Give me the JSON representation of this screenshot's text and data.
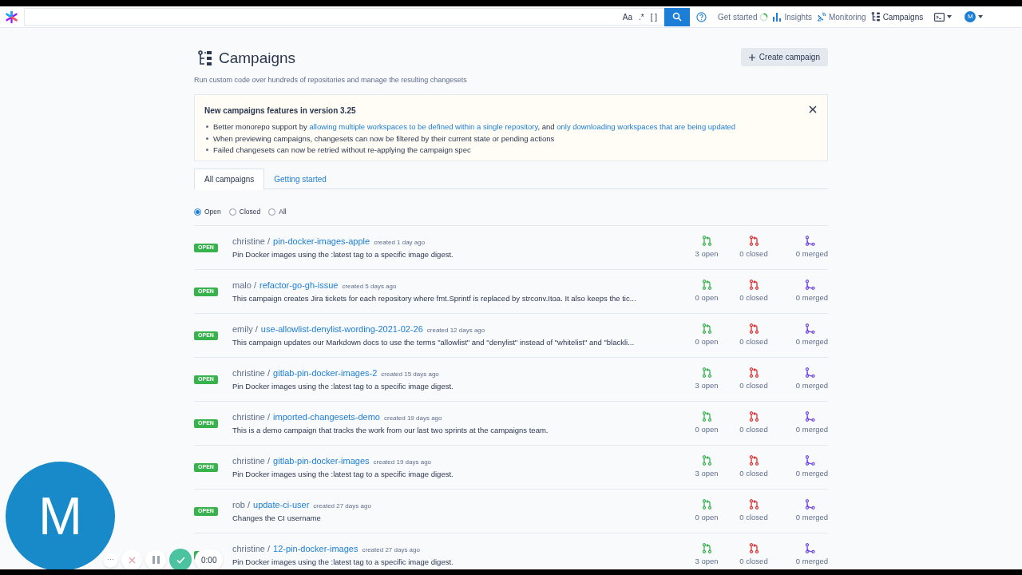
{
  "nav": {
    "search_tokens": [
      "Aa",
      ".*",
      "[ ]"
    ],
    "links": [
      {
        "label": "Get started",
        "kind": "progress"
      },
      {
        "label": "Insights",
        "kind": "insights"
      },
      {
        "label": "Monitoring",
        "kind": "monitoring"
      },
      {
        "label": "Campaigns",
        "kind": "campaigns"
      }
    ],
    "avatar": "M"
  },
  "page": {
    "title": "Campaigns",
    "subtitle": "Run custom code over hundreds of repositories and manage the resulting changesets",
    "create_button": "Create campaign"
  },
  "notice": {
    "title": "New campaigns features in version 3.25",
    "items": [
      [
        "Better monorepo support by ",
        {
          "link": "allowing multiple workspaces to be defined within a single repository"
        },
        ", and ",
        {
          "link": "only downloading workspaces that are being updated"
        }
      ],
      [
        "When previewing campaigns, changesets can now be filtered by their current state or pending actions"
      ],
      [
        "Failed changesets can now be retried without re-applying the campaign spec"
      ]
    ]
  },
  "tabs": [
    {
      "label": "All campaigns",
      "selected": true
    },
    {
      "label": "Getting started",
      "selected": false
    }
  ],
  "filters": [
    {
      "label": "Open",
      "selected": true
    },
    {
      "label": "Closed",
      "selected": false
    },
    {
      "label": "All",
      "selected": false
    }
  ],
  "campaigns": [
    {
      "badge": "OPEN",
      "namespace": "christine /",
      "name": "pin-docker-images-apple",
      "created": "created 1 day ago",
      "description": "Pin Docker images using the :latest tag to a specific image digest.",
      "open": "3 open",
      "closed": "0 closed",
      "merged": "0 merged"
    },
    {
      "badge": "OPEN",
      "namespace": "malo /",
      "name": "refactor-go-gh-issue",
      "created": "created 5 days ago",
      "description": "This campaign creates Jira tickets for each repository where fmt.Sprintf is replaced by strconv.Itoa. It also keeps the tic...",
      "open": "0 open",
      "closed": "0 closed",
      "merged": "0 merged"
    },
    {
      "badge": "OPEN",
      "namespace": "emily /",
      "name": "use-allowlist-denylist-wording-2021-02-26",
      "created": "created 12 days ago",
      "description": "This campaign updates our Markdown docs to use the terms \"allowlist\" and \"denylist\" instead of \"whitelist\" and \"blackli...",
      "open": "0 open",
      "closed": "0 closed",
      "merged": "0 merged"
    },
    {
      "badge": "OPEN",
      "namespace": "christine /",
      "name": "gitlab-pin-docker-images-2",
      "created": "created 15 days ago",
      "description": "Pin Docker images using the :latest tag to a specific image digest.",
      "open": "3 open",
      "closed": "0 closed",
      "merged": "0 merged"
    },
    {
      "badge": "OPEN",
      "namespace": "christine /",
      "name": "imported-changesets-demo",
      "created": "created 19 days ago",
      "description": "This is a demo campaign that tracks the work from our last two sprints at the campaigns team.",
      "open": "0 open",
      "closed": "0 closed",
      "merged": "0 merged"
    },
    {
      "badge": "OPEN",
      "namespace": "christine /",
      "name": "gitlab-pin-docker-images",
      "created": "created 19 days ago",
      "description": "Pin Docker images using the :latest tag to a specific image digest.",
      "open": "3 open",
      "closed": "0 closed",
      "merged": "0 merged"
    },
    {
      "badge": "OPEN",
      "namespace": "rob /",
      "name": "update-ci-user",
      "created": "created 27 days ago",
      "description": "Changes the CI username",
      "open": "0 open",
      "closed": "0 closed",
      "merged": "0 merged"
    },
    {
      "namespace": "christine /",
      "name": "12-pin-docker-images",
      "created": "created 27 days ago",
      "description": "Pin Docker images using the :latest tag to a specific image digest.",
      "open": "3 open",
      "closed": "0 closed",
      "merged": "0 merged"
    }
  ],
  "recorder": {
    "avatar": "M",
    "more": "···",
    "timer": "0:00"
  }
}
